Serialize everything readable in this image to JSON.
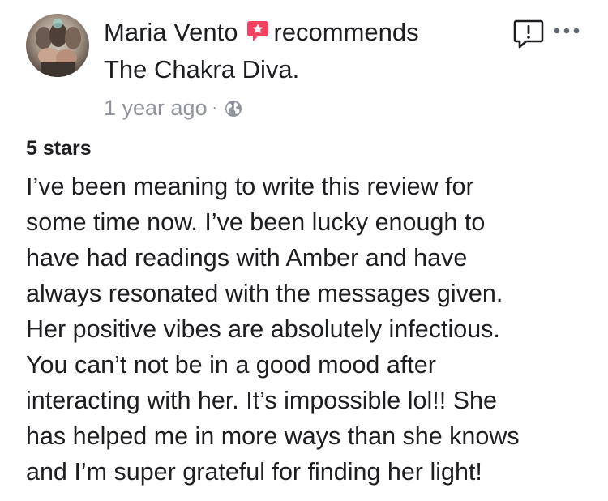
{
  "post": {
    "author_name": "Maria Vento",
    "action_text": "recommends",
    "page_name": "The Chakra Diva.",
    "timestamp": "1 year ago",
    "separator": "·",
    "privacy_icon": "globe-icon",
    "recommend_icon": "recommend-badge-icon"
  },
  "header_actions": {
    "report_icon": "report-icon",
    "more_icon": "more-options-icon"
  },
  "review": {
    "rating_label": "5 stars",
    "lines": [
      "I’ve been meaning to write this review for",
      "some time now. I’ve been lucky enough to",
      "have had readings with Amber and have",
      "always resonated with the messages given.",
      "Her positive vibes are absolutely infectious.",
      "You can’t not be in a good mood after",
      "interacting with her. It’s impossible lol!! She",
      "has helped me in more ways than she knows",
      "and I’m super grateful for finding her light!"
    ]
  },
  "colors": {
    "text_primary": "#1c1e21",
    "text_secondary": "#90949c",
    "recommend_red": "#f3425f",
    "icon_dark": "#1c1e21"
  }
}
